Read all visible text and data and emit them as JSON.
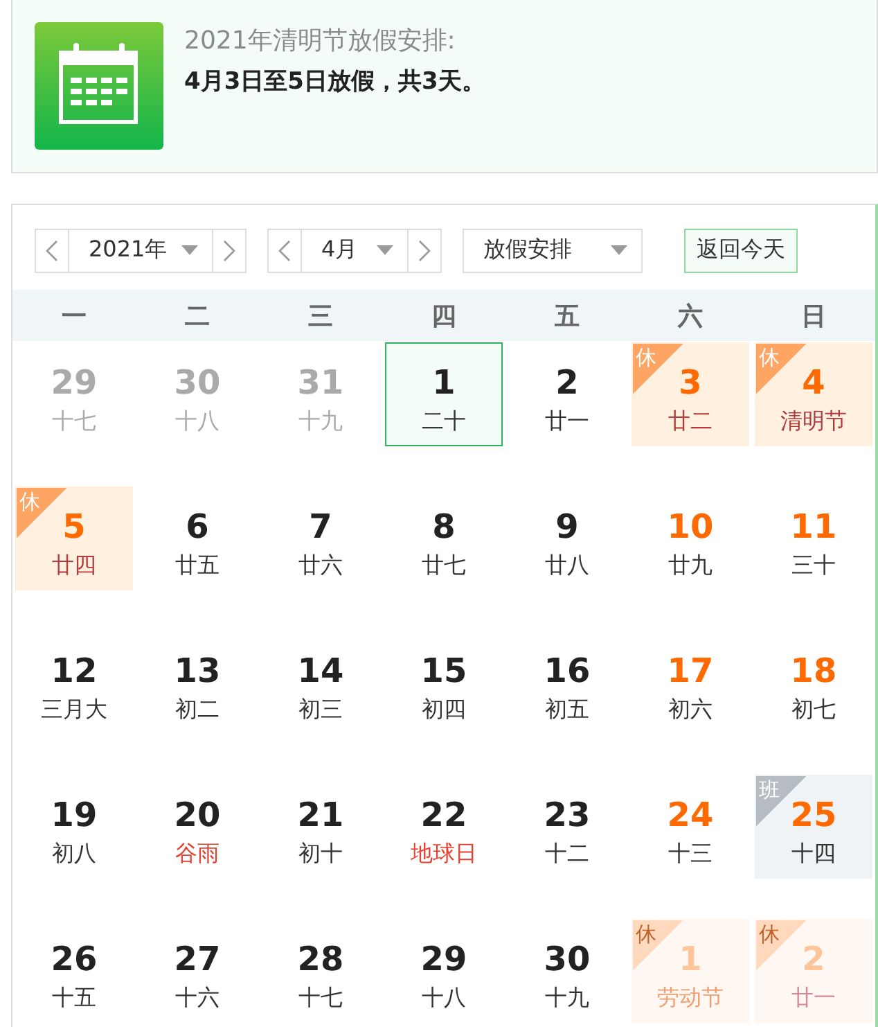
{
  "notice": {
    "title": "2021年清明节放假安排:",
    "summary": "4月3日至5日放假，共3天。"
  },
  "toolbar": {
    "year": "2021年",
    "month": "4月",
    "mode": "放假安排",
    "today_button": "返回今天"
  },
  "weekdays": [
    "一",
    "二",
    "三",
    "四",
    "五",
    "六",
    "日"
  ],
  "weeks": [
    [
      {
        "day": "29",
        "lunar": "十七",
        "kind": "other"
      },
      {
        "day": "30",
        "lunar": "十八",
        "kind": "other"
      },
      {
        "day": "31",
        "lunar": "十九",
        "kind": "other"
      },
      {
        "day": "1",
        "lunar": "二十",
        "kind": "current",
        "today": true
      },
      {
        "day": "2",
        "lunar": "廿一",
        "kind": "current"
      },
      {
        "day": "3",
        "lunar": "廿二",
        "kind": "rest",
        "badge": "休",
        "festival": true
      },
      {
        "day": "4",
        "lunar": "清明节",
        "kind": "rest",
        "badge": "休",
        "festival": true
      }
    ],
    [
      {
        "day": "5",
        "lunar": "廿四",
        "kind": "rest",
        "badge": "休",
        "festival": true
      },
      {
        "day": "6",
        "lunar": "廿五",
        "kind": "current"
      },
      {
        "day": "7",
        "lunar": "廿六",
        "kind": "current"
      },
      {
        "day": "8",
        "lunar": "廿七",
        "kind": "current"
      },
      {
        "day": "9",
        "lunar": "廿八",
        "kind": "current"
      },
      {
        "day": "10",
        "lunar": "廿九",
        "kind": "current",
        "weekend": true
      },
      {
        "day": "11",
        "lunar": "三十",
        "kind": "current",
        "weekend": true
      }
    ],
    [
      {
        "day": "12",
        "lunar": "三月大",
        "kind": "current"
      },
      {
        "day": "13",
        "lunar": "初二",
        "kind": "current"
      },
      {
        "day": "14",
        "lunar": "初三",
        "kind": "current"
      },
      {
        "day": "15",
        "lunar": "初四",
        "kind": "current"
      },
      {
        "day": "16",
        "lunar": "初五",
        "kind": "current"
      },
      {
        "day": "17",
        "lunar": "初六",
        "kind": "current",
        "weekend": true
      },
      {
        "day": "18",
        "lunar": "初七",
        "kind": "current",
        "weekend": true
      }
    ],
    [
      {
        "day": "19",
        "lunar": "初八",
        "kind": "current"
      },
      {
        "day": "20",
        "lunar": "谷雨",
        "kind": "current",
        "festival": true
      },
      {
        "day": "21",
        "lunar": "初十",
        "kind": "current"
      },
      {
        "day": "22",
        "lunar": "地球日",
        "kind": "current",
        "festival": true
      },
      {
        "day": "23",
        "lunar": "十二",
        "kind": "current"
      },
      {
        "day": "24",
        "lunar": "十三",
        "kind": "current",
        "weekend": true
      },
      {
        "day": "25",
        "lunar": "十四",
        "kind": "work",
        "weekend": true,
        "badge": "班"
      }
    ],
    [
      {
        "day": "26",
        "lunar": "十五",
        "kind": "current"
      },
      {
        "day": "27",
        "lunar": "十六",
        "kind": "current"
      },
      {
        "day": "28",
        "lunar": "十七",
        "kind": "current"
      },
      {
        "day": "29",
        "lunar": "十八",
        "kind": "current"
      },
      {
        "day": "30",
        "lunar": "十九",
        "kind": "current"
      },
      {
        "day": "1",
        "lunar": "劳动节",
        "kind": "other_rest",
        "badge": "休",
        "festival": true
      },
      {
        "day": "2",
        "lunar": "廿一",
        "kind": "other_rest",
        "badge": "休",
        "festival": false
      }
    ]
  ]
}
